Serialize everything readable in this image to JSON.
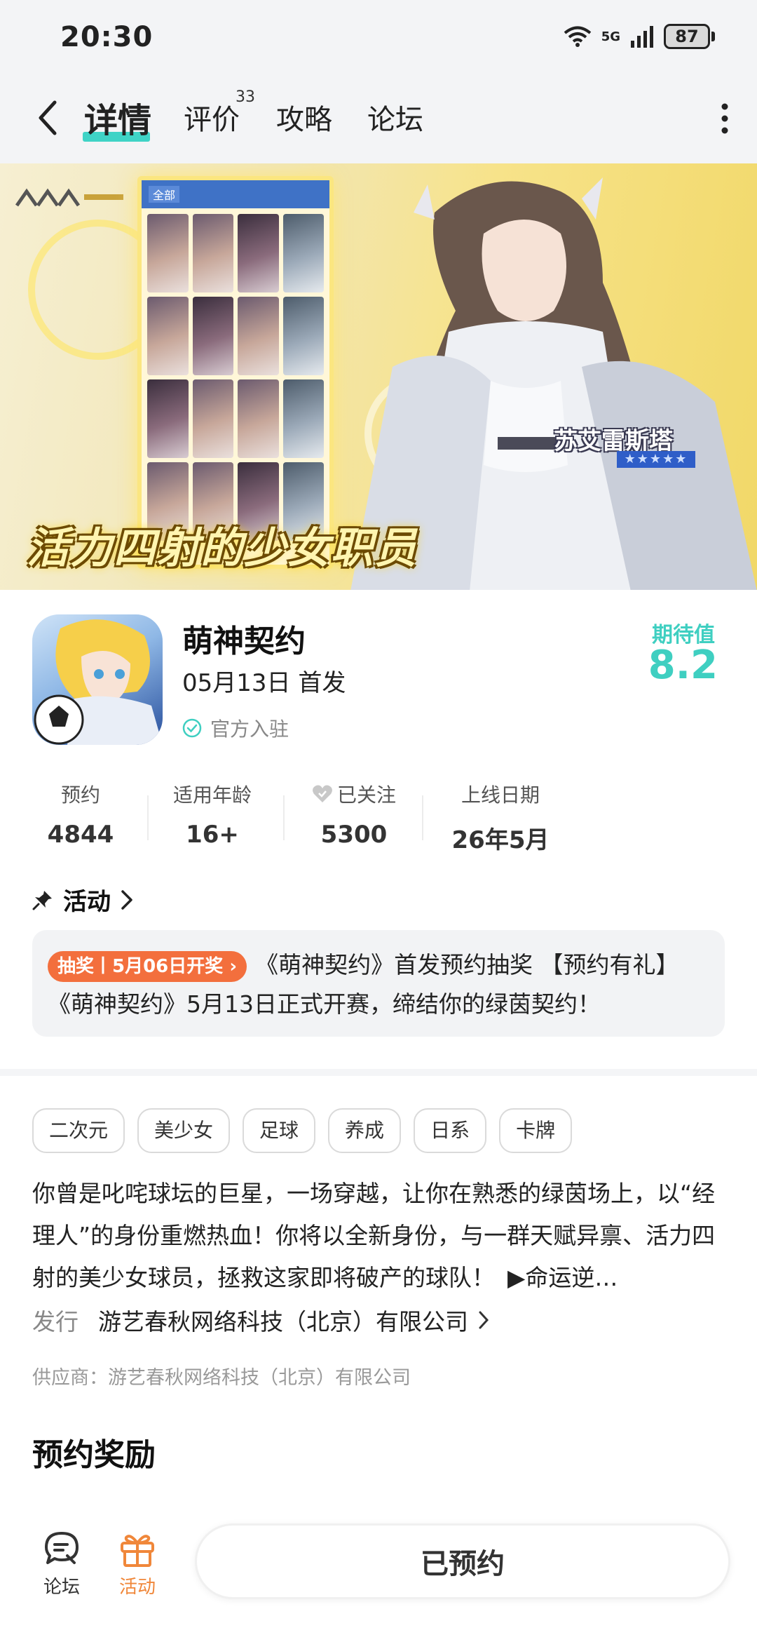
{
  "status_bar": {
    "time": "20:30",
    "network": "5G",
    "battery": "87"
  },
  "nav": {
    "tabs": [
      {
        "label": "详情",
        "active": true
      },
      {
        "label": "评价",
        "badge": "33"
      },
      {
        "label": "攻略"
      },
      {
        "label": "论坛"
      }
    ],
    "accent_color": "#3fd3c6"
  },
  "banner": {
    "slogan": "活力四射的少女职员",
    "character_name": "苏艾雷斯塔",
    "grid_tab": "全部"
  },
  "game": {
    "title": "萌神契约",
    "release": "05月13日 首发",
    "official": "官方入驻",
    "expect_label": "期待值",
    "expect_value": "8.2"
  },
  "stats": [
    {
      "label": "预约",
      "value": "4844"
    },
    {
      "label": "适用年龄",
      "value": "16+"
    },
    {
      "label": "已关注",
      "value": "5300"
    },
    {
      "label": "上线日期",
      "value": "26年5月"
    }
  ],
  "activity": {
    "title": "活动",
    "badge": "抽奖丨5月06日开奖",
    "text": "《萌神契约》首发预约抽奖 【预约有礼】《萌神契约》5月13日正式开赛，缔结你的绿茵契约！"
  },
  "tags": [
    "二次元",
    "美少女",
    "足球",
    "养成",
    "日系",
    "卡牌"
  ],
  "description": {
    "text": "你曾是叱咤球坛的巨星，一场穿越，让你在熟悉的绿茵场上，以“经理人”的身份重燃热血！你将以全新身份，与一群天赋异禀、活力四射的美少女球员，拯救这家即将破产的球队！",
    "more": "▶命运逆…"
  },
  "publisher": {
    "label": "发行",
    "name": "游艺春秋网络科技（北京）有限公司"
  },
  "supplier": "供应商：游艺春秋网络科技（北京）有限公司",
  "reward_title": "预约奖励",
  "bottom_bar": {
    "forum_label": "论坛",
    "activity_label": "活动",
    "reserve_label": "已预约",
    "activity_color": "#f0873a"
  }
}
